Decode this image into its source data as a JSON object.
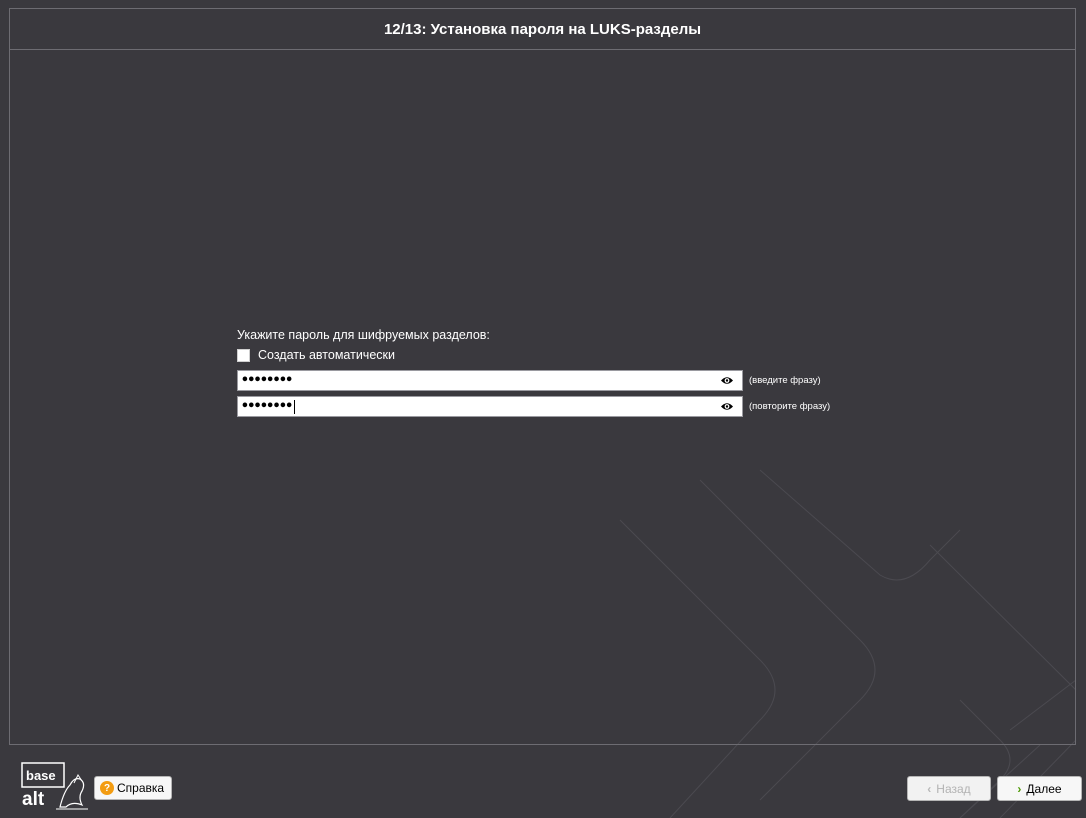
{
  "window": {
    "title": "12/13: Установка пароля на LUKS-разделы"
  },
  "form": {
    "prompt": "Укажите пароль для шифруемых разделов:",
    "auto_checkbox": {
      "label": "Создать автоматически",
      "checked": false
    },
    "password_field": {
      "value": "••••••••",
      "hint": "(введите фразу)",
      "toggle_icon": "eye-icon"
    },
    "confirm_field": {
      "value": "••••••••",
      "hint": "(повторите фразу)",
      "toggle_icon": "eye-icon"
    }
  },
  "footer": {
    "logo_text_top": "base",
    "logo_text_bottom": "alt",
    "help_label": "Справка",
    "back_label": "Назад",
    "next_label": "Далее",
    "back_enabled": false
  },
  "colors": {
    "background": "#3a393e",
    "border": "#6d6c72",
    "help_icon": "#f39c12",
    "next_chevron": "#4e9a06"
  }
}
